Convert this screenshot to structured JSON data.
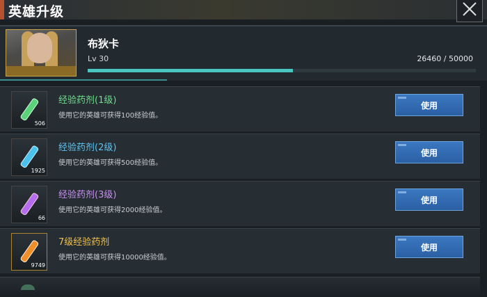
{
  "header": {
    "title": "英雄升级"
  },
  "hero": {
    "name": "布狄卡",
    "level": "Lv 30",
    "exp_text": "26460 / 50000",
    "exp_fraction": 0.5292
  },
  "items": [
    {
      "name": "经验药剂(1级)",
      "desc": "使用它的英雄可获得100经验值。",
      "count": "506",
      "color": "#6fdc8c",
      "vial": "#5ad27a",
      "button": "使用"
    },
    {
      "name": "经验药剂(2级)",
      "desc": "使用它的英雄可获得500经验值。",
      "count": "1925",
      "color": "#5ec3f0",
      "vial": "#49c2ec",
      "button": "使用"
    },
    {
      "name": "经验药剂(3级)",
      "desc": "使用它的英雄可获得2000经验值。",
      "count": "66",
      "color": "#c890f0",
      "vial": "#b56cf0",
      "button": "使用"
    },
    {
      "name": "7级经验药剂",
      "desc": "使用它的英雄可获得10000经验值。",
      "count": "9749",
      "color": "#f0c14a",
      "vial": "#f08f2a",
      "button": "使用"
    }
  ]
}
